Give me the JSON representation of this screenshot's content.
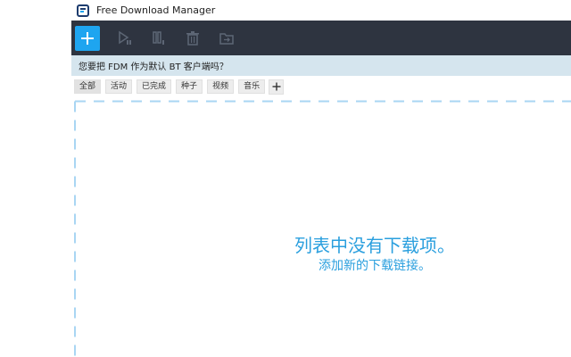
{
  "window": {
    "title": "Free Download Manager"
  },
  "toolbar": {
    "add_icon": "plus-icon",
    "buttons": [
      "play-icon",
      "pause-icon",
      "trash-icon",
      "move-folder-icon"
    ],
    "toolbar_bg": "#2e3440",
    "accent": "#1ea5f0"
  },
  "notice": {
    "text": "您要把 FDM 作为默认 BT 客户端吗？",
    "bg": "#d5e5ee"
  },
  "tabs": [
    {
      "label": "全部"
    },
    {
      "label": "活动"
    },
    {
      "label": "已完成"
    },
    {
      "label": "种子"
    },
    {
      "label": "视频"
    },
    {
      "label": "音乐"
    }
  ],
  "empty_state": {
    "title": "列表中没有下载项。",
    "subtitle": "添加新的下载链接。",
    "color": "#2a9fde"
  }
}
